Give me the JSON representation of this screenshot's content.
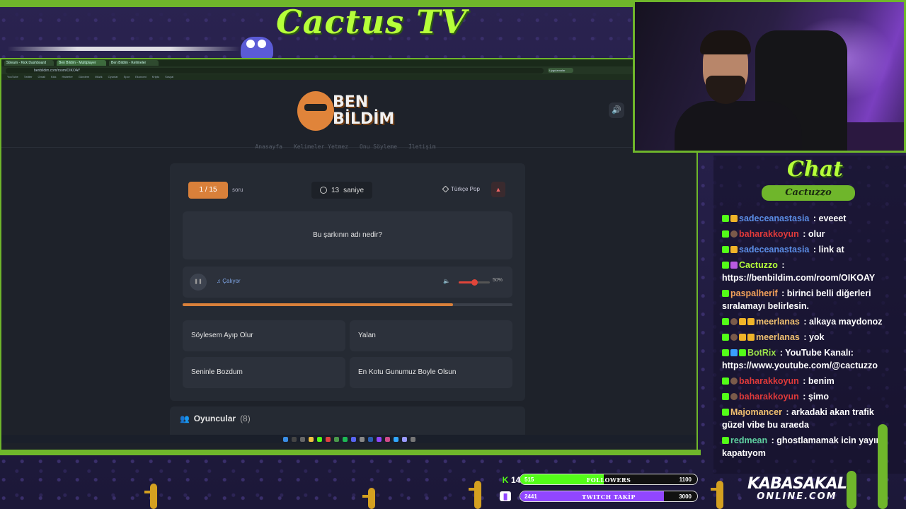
{
  "overlay": {
    "brand": "Cactus TV",
    "chat_title": "Chat",
    "chat_brand": "Cactuzzo",
    "sponsor_top": "KABASAKAL",
    "sponsor_bottom": "ONLINE.COM",
    "accent": "#6fb62b",
    "brand_color": "#b6ff3a"
  },
  "browser": {
    "tabs": [
      "Stream - Kick Dashboard",
      "Ben Bildim - Multiplayer",
      "Ben Bildim - Kelimeler"
    ],
    "url": "benbildim.com/room/OIKOAY",
    "extension_label": "Uygulamalar",
    "bookmarks": [
      "YouTube",
      "Twitter",
      "Gmail",
      "Kick",
      "Haberler",
      "Gündem",
      "Müzik",
      "Oyunlar",
      "Spor",
      "Ekonomi",
      "Kripto",
      "Sosyal"
    ]
  },
  "site": {
    "logo_line1": "BEN",
    "logo_line2": "BİLDİM",
    "nav": [
      "Anasayfa",
      "Kelimeler Yetmez",
      "Onu Söyleme",
      "İletişim"
    ],
    "speaker_icon": "speaker-icon"
  },
  "game": {
    "counter": "1 / 15",
    "counter_unit": "soru",
    "timer_value": "13",
    "timer_unit": "saniye",
    "genre": "Türkçe Pop",
    "question": "Bu şarkının adı nedir?",
    "playing_label": "Çalıyor",
    "volume_percent": 50,
    "volume_label": "50%",
    "progress_fraction": 0.82,
    "answers": [
      "Söylesem Ayıp Olur",
      "Yalan",
      "Seninle Bozdum",
      "En Kotu Gunumuz Boyle Olsun"
    ],
    "players_title": "Oyuncular",
    "players_count": "(8)"
  },
  "chat": [
    {
      "user": "sadeceanastasia",
      "color": "#5b8de6",
      "badges": [
        "k",
        "gold"
      ],
      "message": "eveeet"
    },
    {
      "user": "baharakkoyun",
      "color": "#e03a3a",
      "badges": [
        "k",
        "dark"
      ],
      "message": "olur"
    },
    {
      "user": "sadeceanastasia",
      "color": "#5b8de6",
      "badges": [
        "k",
        "gold"
      ],
      "message": "link at"
    },
    {
      "user": "Cactuzzo",
      "color": "#b6ff3a",
      "badges": [
        "k",
        "mic"
      ],
      "message": "https://benbildim.com/room/OIKOAY"
    },
    {
      "user": "paspalherif",
      "color": "#f2a15a",
      "badges": [
        "k"
      ],
      "message": "birinci belli diğerleri sıralamayı belirlesin."
    },
    {
      "user": "meerlanas",
      "color": "#f0c070",
      "badges": [
        "k",
        "dark",
        "gold",
        "gold"
      ],
      "message": "alkaya maydonoz"
    },
    {
      "user": "meerlanas",
      "color": "#f0c070",
      "badges": [
        "k",
        "dark",
        "gold",
        "gold"
      ],
      "message": "yok"
    },
    {
      "user": "BotRix",
      "color": "#9be24a",
      "badges": [
        "k",
        "blue",
        "k"
      ],
      "message": "YouTube Kanalı: https://www.youtube.com/@cactuzzo"
    },
    {
      "user": "baharakkoyun",
      "color": "#e03a3a",
      "badges": [
        "k",
        "dark"
      ],
      "message": "benim"
    },
    {
      "user": "baharakkoyun",
      "color": "#e03a3a",
      "badges": [
        "k",
        "dark"
      ],
      "message": "şimo"
    },
    {
      "user": "Majomancer",
      "color": "#f0c070",
      "badges": [
        "k"
      ],
      "message": "arkadaki akan trafik güzel vibe bu araeda"
    },
    {
      "user": "redmean",
      "color": "#5fd0a0",
      "badges": [
        "k"
      ],
      "message": "ghostlamamak icin yayını kapatıyom"
    }
  ],
  "stats": {
    "kick_number": "14",
    "followers_current": "515",
    "followers_label": "FOLLOWERS",
    "followers_goal": "1100",
    "followers_fraction": 0.47,
    "followers_color": "#53fc18",
    "twitch_current": "2441",
    "twitch_label": "TWITCH TAKİP",
    "twitch_goal": "3000",
    "twitch_fraction": 0.81,
    "twitch_color": "#9146ff"
  }
}
